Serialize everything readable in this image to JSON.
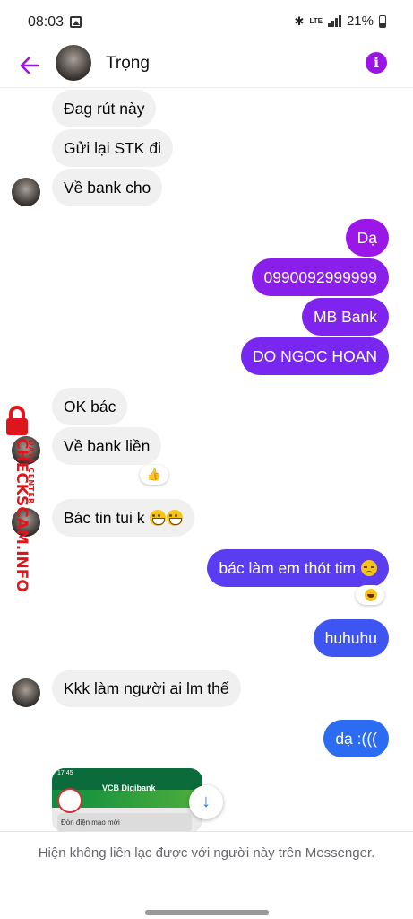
{
  "status_bar": {
    "time": "08:03",
    "network": "LTE",
    "battery": "21%"
  },
  "header": {
    "contact_name": "Trọng",
    "accent_color": "#9b15e6"
  },
  "messages": [
    {
      "from": "them",
      "text": "Đag rút này"
    },
    {
      "from": "them",
      "text": "Gửi lại STK đi"
    },
    {
      "from": "them",
      "text": "Về bank cho"
    },
    {
      "from": "me",
      "text": "Dạ"
    },
    {
      "from": "me",
      "text": "0990092999999"
    },
    {
      "from": "me",
      "text": "MB Bank"
    },
    {
      "from": "me",
      "text": "DO NGOC HOAN"
    },
    {
      "from": "them",
      "text": "OK bác"
    },
    {
      "from": "them",
      "text": "Về bank liền",
      "reaction": "thumbs-up"
    },
    {
      "from": "them",
      "text": "Bác tin tui k",
      "emoji": [
        "grinning-face",
        "grinning-face"
      ]
    },
    {
      "from": "me",
      "text": "bác làm em thót tim",
      "emoji": [
        "disappointed-face"
      ],
      "reaction": "laughing-face"
    },
    {
      "from": "me",
      "text": "huhuhu"
    },
    {
      "from": "them",
      "text": "Kkk làm người ai lm thế"
    },
    {
      "from": "me",
      "text": "dạ :((("
    },
    {
      "from": "them",
      "type": "image",
      "image_text": {
        "brand": "VCB Digibank",
        "time": "17:45",
        "caption": "Đòn điện mao mời"
      }
    }
  ],
  "footer": {
    "notice": "Hiện không liên lạc được với người này trên Messenger."
  },
  "watermark": {
    "main": "CHECKSCAM.INFO",
    "sub": "DATA CENTER"
  },
  "colors": {
    "outgoing_top": "#a012e8",
    "outgoing_mid": "#6a2ff0",
    "outgoing_bottom": "#2a6ff2",
    "incoming": "#f0f0f0",
    "watermark": "#e0151b"
  }
}
